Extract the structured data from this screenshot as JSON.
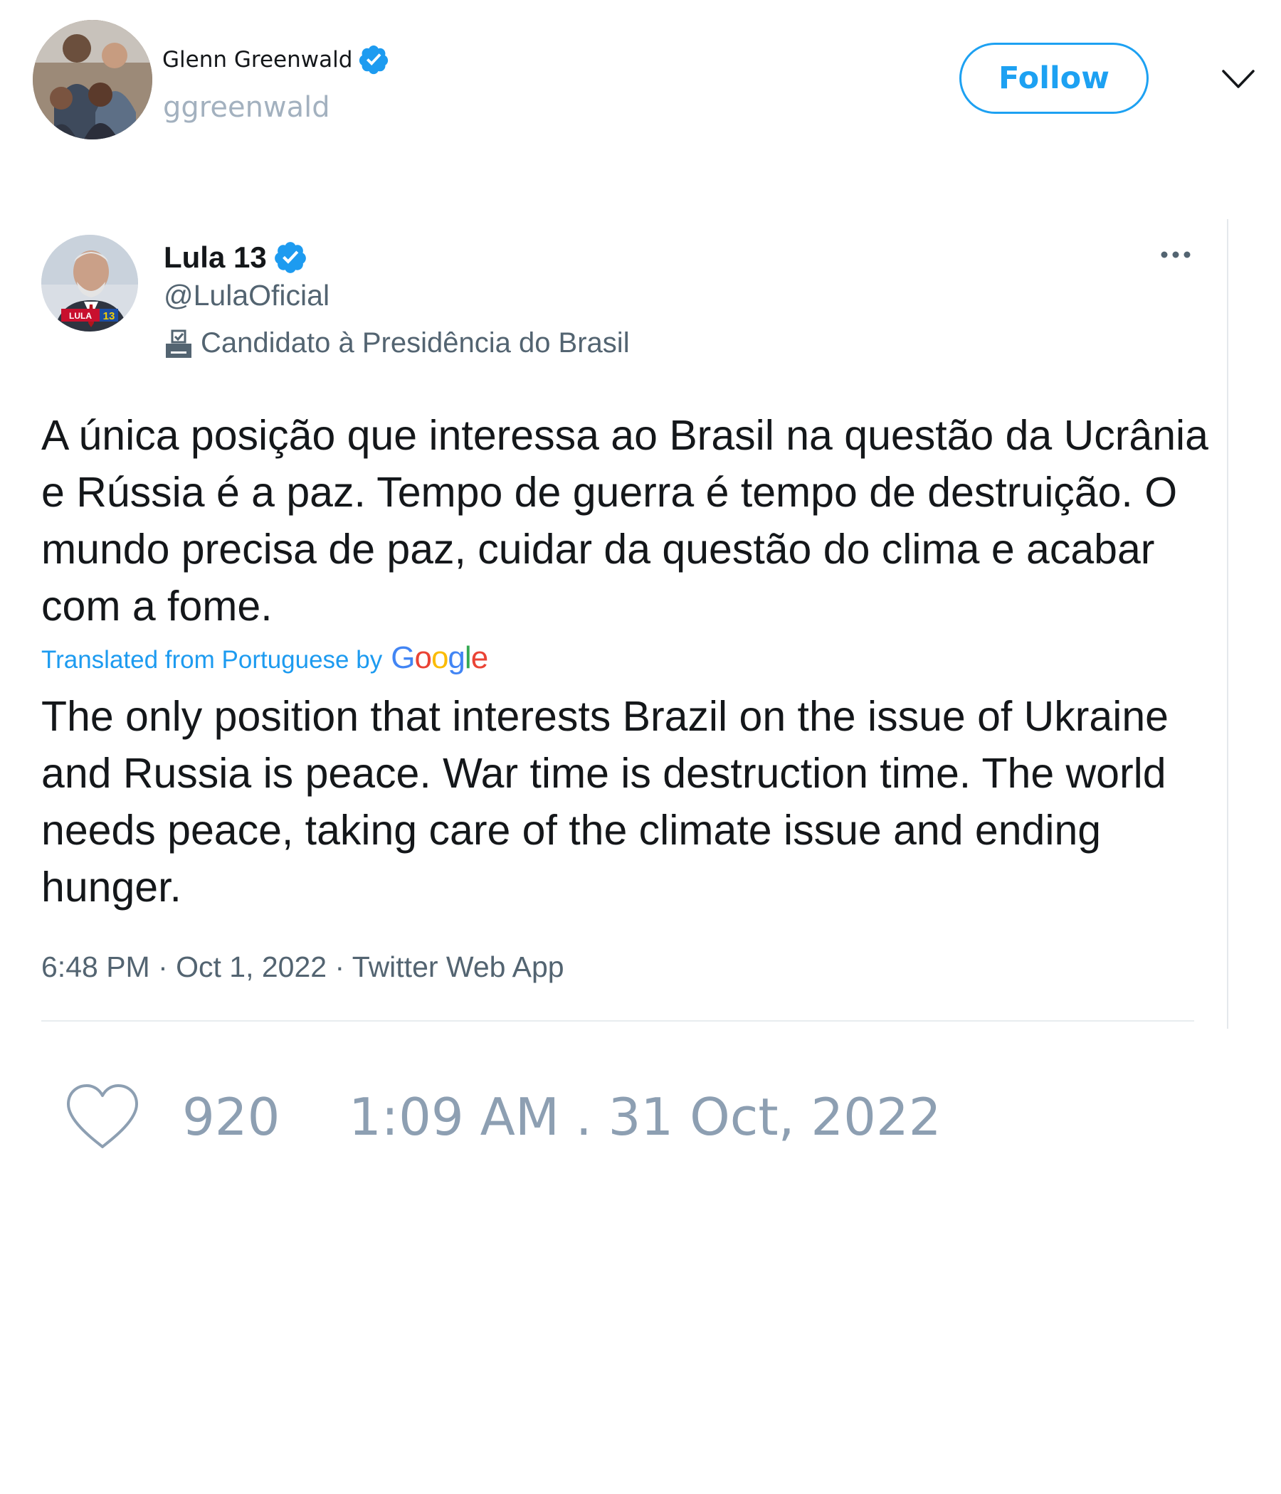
{
  "header": {
    "author_name": "Glenn Greenwald",
    "author_handle": "ggreenwald",
    "follow_label": "Follow"
  },
  "quoted_tweet": {
    "author_name": "Lula 13",
    "author_handle": "@LulaOficial",
    "bio_label": "Candidato à Presidência do Brasil",
    "avatar_text": "LULA 13",
    "text_original": "A única posição que interessa ao Brasil na questão da Ucrânia e Rússia é a paz. Tempo de guerra é tempo de destruição. O mundo precisa de paz, cuidar da questão do clima e acabar com a fome.",
    "translation_label": "Translated from Portuguese by",
    "translation_provider": "Google",
    "text_translated": "The only position that interests Brazil on the issue of Ukraine and Russia is peace. War time is destruction time. The world needs peace, taking care of the climate issue and ending hunger.",
    "meta": "6:48 PM · Oct 1, 2022 · Twitter Web App"
  },
  "footer": {
    "like_count": "920",
    "timestamp": "1:09 AM . 31 Oct, 2022"
  },
  "icons": {
    "verified": "verified-badge-icon",
    "follow_dropdown": "chevron-down-icon",
    "more": "more-options-icon",
    "bio": "ballot-box-icon",
    "like": "heart-icon"
  },
  "colors": {
    "accent": "#1da1f2",
    "secondary_text": "#536471",
    "muted_text": "#8d9fb2",
    "handle_text": "#a3b1bf"
  }
}
